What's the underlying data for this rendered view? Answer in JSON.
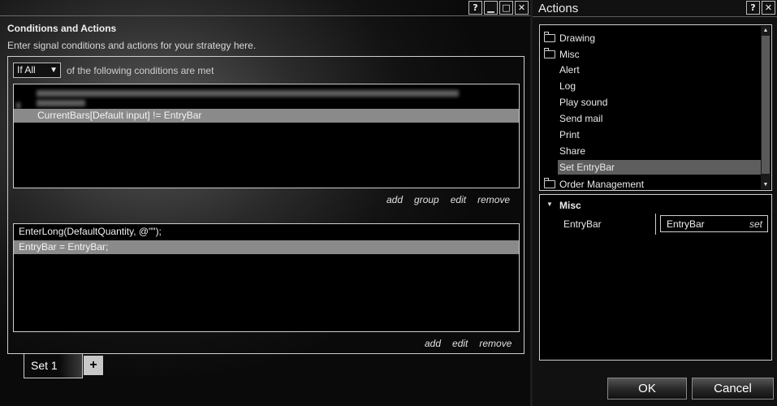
{
  "left_window": {
    "title": "Conditions and Actions",
    "subtitle": "Enter signal conditions and actions for your strategy here.",
    "condition_mode": "If All",
    "condition_mode_suffix": "of the following conditions are met",
    "conditions": [
      {
        "label": "CurrentBars[Default input] != EntryBar",
        "selected": true
      }
    ],
    "condition_links": [
      "add",
      "group",
      "edit",
      "remove"
    ],
    "actions": [
      {
        "label": "EnterLong(DefaultQuantity, @\"\");",
        "selected": false
      },
      {
        "label": "EntryBar = EntryBar;",
        "selected": true
      }
    ],
    "action_links": [
      "add",
      "edit",
      "remove"
    ],
    "tabs": [
      {
        "label": "Set 1",
        "active": true
      }
    ],
    "add_tab_label": "+",
    "window_buttons": [
      "?",
      "▁",
      "□",
      "✕"
    ]
  },
  "right_window": {
    "title": "Actions",
    "window_buttons": [
      "?",
      "✕"
    ],
    "tree": [
      {
        "label": "Drawing",
        "type": "folder"
      },
      {
        "label": "Misc",
        "type": "folder"
      },
      {
        "label": "Alert",
        "type": "item"
      },
      {
        "label": "Log",
        "type": "item"
      },
      {
        "label": "Play sound",
        "type": "item"
      },
      {
        "label": "Send mail",
        "type": "item"
      },
      {
        "label": "Print",
        "type": "item"
      },
      {
        "label": "Share",
        "type": "item"
      },
      {
        "label": "Set EntryBar",
        "type": "item",
        "selected": true
      },
      {
        "label": "Order Management",
        "type": "folder"
      }
    ],
    "props": {
      "category": "Misc",
      "name": "EntryBar",
      "value": "EntryBar",
      "set_label": "set"
    },
    "ok_label": "OK",
    "cancel_label": "Cancel"
  },
  "colors": {
    "selection": "#8a8a8a",
    "tree_selection": "#5e5e5e",
    "border": "#cfcfcf"
  }
}
